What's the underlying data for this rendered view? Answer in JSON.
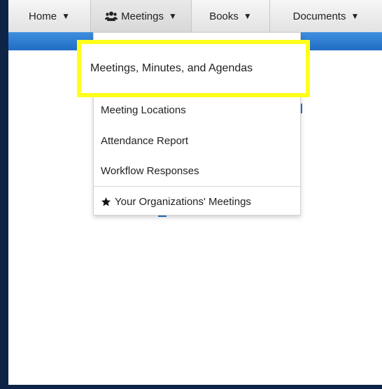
{
  "navbar": {
    "items": [
      {
        "label": "Home",
        "icon": "",
        "caret": "▼"
      },
      {
        "label": "Meetings",
        "icon": "people-icon",
        "caret": "▼"
      },
      {
        "label": "Books",
        "icon": "",
        "caret": "▼"
      },
      {
        "label": "Documents",
        "icon": "",
        "caret": "▼"
      }
    ]
  },
  "dropdown": {
    "highlighted_item": "Meetings, Minutes, and Agendas",
    "items": [
      "Meeting Locations",
      "Attendance Report",
      "Workflow Responses"
    ],
    "footer_item": {
      "label": "Your Organizations' Meetings",
      "icon": "star-icon"
    }
  },
  "colors": {
    "frame": "#0d2446",
    "navbar_bg": "#e6e6e6",
    "blue_bar": "#2a74c9",
    "highlight_border": "#ffff1c"
  }
}
